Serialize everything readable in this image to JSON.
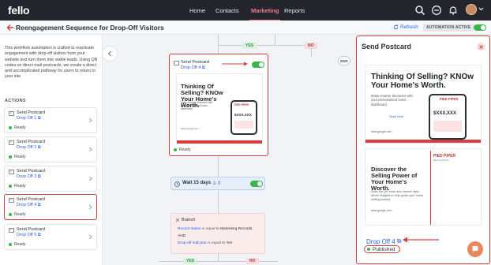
{
  "nav": {
    "logo": "fello",
    "links": [
      "Home",
      "Contacts",
      "Marketing",
      "Reports"
    ],
    "active": "Marketing"
  },
  "header": {
    "title": "Reengagement Sequence for Drop-Off Visitors",
    "refresh": "Refresh",
    "automation_badge": "AUTOMATION ACTIVE"
  },
  "sidebar": {
    "description": "This workflow automation is crafted to reactivate engagement with drop-off visitors from your website and turn them into viable leads. Using QR codes on direct mail postcards, we create a direct and uncomplicated pathway for users to return to your site.",
    "actions_title": "ACTIONS",
    "actions": [
      {
        "name": "Send Postcard",
        "link": "Drop Off 1",
        "status": "Ready"
      },
      {
        "name": "Send Postcard",
        "link": "Drop Off 2",
        "status": "Ready"
      },
      {
        "name": "Send Postcard",
        "link": "Drop Off 3",
        "status": "Ready"
      },
      {
        "name": "Send Postcard",
        "link": "Drop Off 4",
        "status": "Ready"
      },
      {
        "name": "Send Postcard",
        "link": "Drop Off 5",
        "status": "Ready"
      }
    ]
  },
  "canvas": {
    "yes_label": "YES",
    "no_label": "NO",
    "end_label": "END",
    "postcard_node": {
      "title": "Send Postcard",
      "link": "Drop Off 4",
      "status": "Ready"
    },
    "wait_node": {
      "label": "Wait 15 days",
      "count": "0"
    },
    "branch_node": {
      "title": "Branch",
      "cond1_field": "Record status",
      "cond1_op": "is equal to",
      "cond1_value": "Marketing Records",
      "and_label": "AND",
      "cond2_field": "Drop-off Indicator",
      "cond2_op": "is equal to",
      "cond2_value": "Yes"
    }
  },
  "postcard": {
    "headline": "Thinking Of Selling? KNOw Your Home's Worth.",
    "subtext": "Make smarter decisions with your personalized home dashboard",
    "scan_label": "Scan here",
    "price": "$XXX,XXX",
    "brand": "PIED PIPER",
    "brand_sub": "REAL ESTATE",
    "site": "www.google.com",
    "back_headline": "Discover the Selling Power of Your Home's Worth.",
    "back_text": "Scan the QR code and explore data-driven insights to help guide your home selling journey."
  },
  "panel": {
    "title": "Send Postcard",
    "link": "Drop Off 4",
    "status": "Published"
  },
  "colors": {
    "nav_bg": "#23262d",
    "accent": "#f07a8a",
    "highlight": "#d63f3f",
    "link": "#2563eb",
    "ready": "#39b54a"
  }
}
